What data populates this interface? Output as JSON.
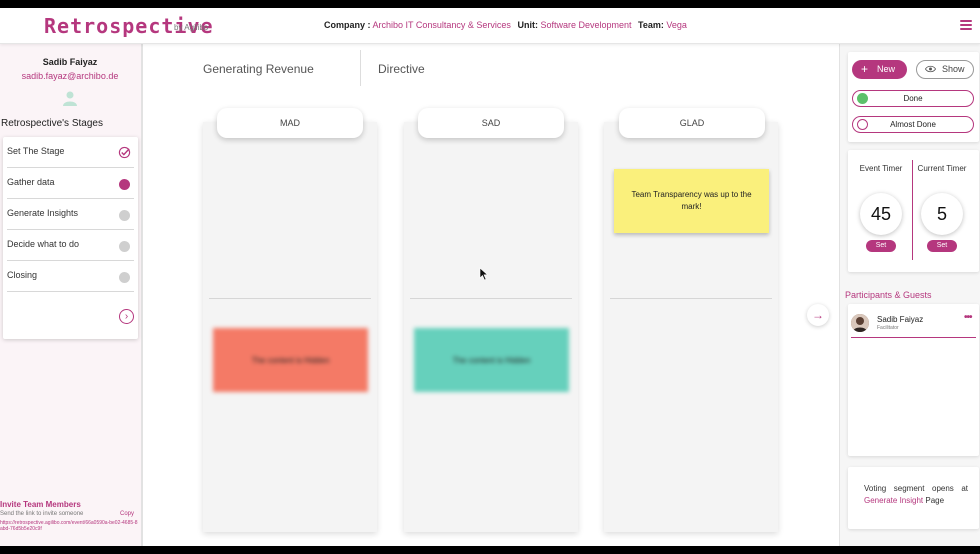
{
  "header": {
    "logo": "Retrospective",
    "logo_by": "by Agilibo",
    "company_label": "Company :",
    "company_value": "Archibo IT Consultancy & Services",
    "unit_label": "Unit:",
    "unit_value": "Software Development",
    "team_label": "Team:",
    "team_value": "Vega"
  },
  "user": {
    "name": "Sadib Faiyaz",
    "email": "sadib.fayaz@archibo.de"
  },
  "stages": {
    "title": "Retrospective's Stages",
    "items": [
      {
        "label": "Set The Stage",
        "status": "done"
      },
      {
        "label": "Gather data",
        "status": "active"
      },
      {
        "label": "Generate Insights",
        "status": "pending"
      },
      {
        "label": "Decide what to do",
        "status": "pending"
      },
      {
        "label": "Closing",
        "status": "pending"
      }
    ]
  },
  "invite": {
    "title": "Invite Team Members",
    "subtitle": "Send the link to invite someone",
    "copy_label": "Copy",
    "link": "https://retrospective.agilibo.com/event/66a0590a-be02-4685-8abd-76d5b5e20c9f"
  },
  "main": {
    "tabs": [
      "Generating Revenue",
      "Directive"
    ],
    "columns": [
      {
        "title": "MAD",
        "card_text": "The content is Hidden",
        "card_color": "#f47a66"
      },
      {
        "title": "SAD",
        "card_text": "The content is Hidden",
        "card_color": "#66d0bc"
      },
      {
        "title": "GLAD",
        "card_text": "Team Transparency was up to the mark!",
        "card_color": "#faf07c"
      }
    ]
  },
  "actions": {
    "new_label": "New",
    "show_label": "Show",
    "done_label": "Done",
    "almost_done_label": "Almost Done"
  },
  "timers": {
    "event_label": "Event Timer",
    "event_value": "45",
    "current_label": "Current Timer",
    "current_value": "5",
    "set_label": "Set"
  },
  "participants": {
    "title": "Participants & Guests",
    "list": [
      {
        "name": "Sadib Faiyaz",
        "role": "Facilitator"
      }
    ]
  },
  "voting": {
    "text_prefix": "Voting segment opens at",
    "link_text": "Generate Insight",
    "text_suffix": "Page"
  },
  "colors": {
    "accent": "#b5377e",
    "done_green": "#5cc16a"
  }
}
